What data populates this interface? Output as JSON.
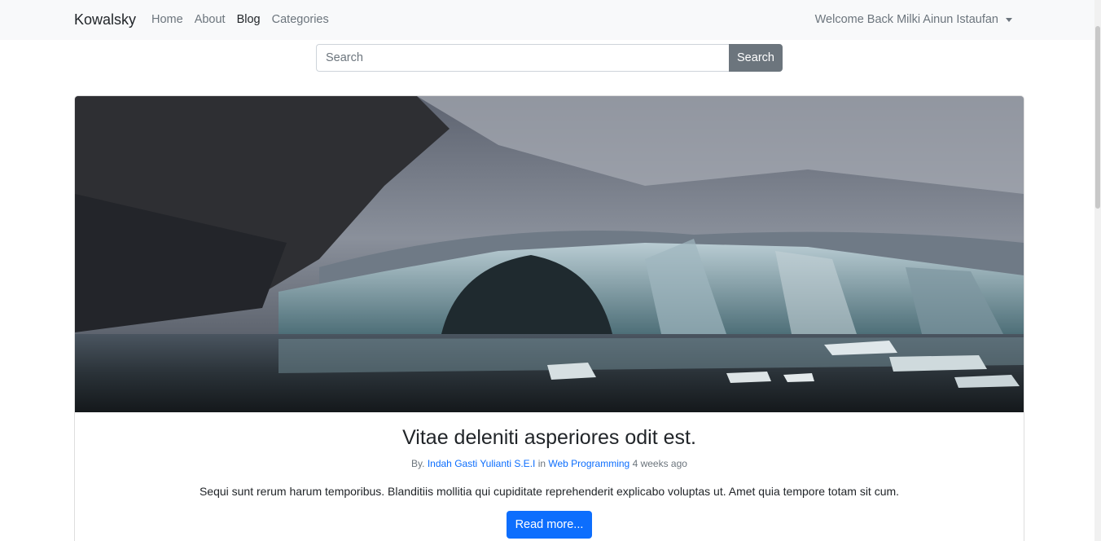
{
  "navbar": {
    "brand": "Kowalsky",
    "links": [
      {
        "label": "Home",
        "active": false
      },
      {
        "label": "About",
        "active": false
      },
      {
        "label": "Blog",
        "active": true
      },
      {
        "label": "Categories",
        "active": false
      }
    ],
    "user_menu": "Welcome Back Milki Ainun Istaufan"
  },
  "search": {
    "placeholder": "Search",
    "button_label": "Search"
  },
  "post": {
    "title": "Vitae deleniti asperiores odit est.",
    "meta_by": "By.",
    "author": "Indah Gasti Yulianti S.E.I",
    "meta_in": "in",
    "category": "Web Programming",
    "time_ago": "4 weeks ago",
    "excerpt": "Sequi sunt rerum harum temporibus. Blanditiis mollitia qui cupiditate reprehenderit explicabo voluptas ut. Amet quia tempore totam sit cum.",
    "read_more_label": "Read more..."
  },
  "colors": {
    "navbar_bg": "#f8f9fa",
    "primary": "#0d6efd",
    "secondary": "#6c757d"
  }
}
